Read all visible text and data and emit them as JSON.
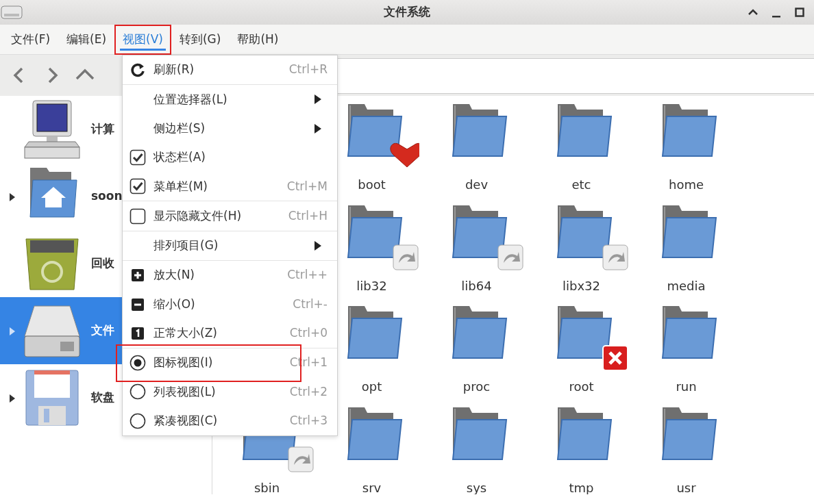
{
  "window": {
    "title": "文件系统"
  },
  "menubar": [
    {
      "label": "文件(F)",
      "selected": false,
      "highlighted": false
    },
    {
      "label": "编辑(E)",
      "selected": false,
      "highlighted": false
    },
    {
      "label": "视图(V)",
      "selected": true,
      "highlighted": true
    },
    {
      "label": "转到(G)",
      "selected": false,
      "highlighted": false
    },
    {
      "label": "帮助(H)",
      "selected": false,
      "highlighted": false
    }
  ],
  "sidebar": {
    "items": [
      {
        "label": "计算",
        "kind": "computer",
        "expandable": false,
        "selected": false
      },
      {
        "label": "soon",
        "kind": "home",
        "expandable": true,
        "selected": false
      },
      {
        "label": "回收",
        "kind": "trash",
        "expandable": false,
        "selected": false
      },
      {
        "label": "文件",
        "kind": "drive",
        "expandable": true,
        "selected": true
      },
      {
        "label": "软盘",
        "kind": "floppy",
        "expandable": true,
        "selected": false
      }
    ]
  },
  "view_menu": {
    "sections": [
      [
        {
          "kind": "action",
          "label": "刷新(R)",
          "shortcut": "Ctrl+R",
          "highlighted": false
        }
      ],
      [
        {
          "kind": "submenu",
          "label": "位置选择器(L)",
          "highlighted": false
        },
        {
          "kind": "submenu",
          "label": "侧边栏(S)",
          "highlighted": false
        },
        {
          "kind": "check",
          "label": "状态栏(A)",
          "checked": true,
          "highlighted": false
        },
        {
          "kind": "check",
          "label": "菜单栏(M)",
          "shortcut": "Ctrl+M",
          "checked": true,
          "highlighted": false
        }
      ],
      [
        {
          "kind": "check",
          "label": "显示隐藏文件(H)",
          "shortcut": "Ctrl+H",
          "checked": false,
          "highlighted": false
        }
      ],
      [
        {
          "kind": "submenu",
          "label": "排列项目(G)",
          "highlighted": false
        }
      ],
      [
        {
          "kind": "action",
          "label": "放大(N)",
          "shortcut": "Ctrl++",
          "highlighted": false
        },
        {
          "kind": "action",
          "label": "缩小(O)",
          "shortcut": "Ctrl+-",
          "highlighted": false
        },
        {
          "kind": "action",
          "label": "正常大小(Z)",
          "shortcut": "Ctrl+0",
          "highlighted": false
        }
      ],
      [
        {
          "kind": "radio",
          "label": "图标视图(I)",
          "shortcut": "Ctrl+1",
          "selected": true,
          "highlighted": true
        },
        {
          "kind": "radio",
          "label": "列表视图(L)",
          "shortcut": "Ctrl+2",
          "selected": false,
          "highlighted": false
        },
        {
          "kind": "radio",
          "label": "紧凑视图(C)",
          "shortcut": "Ctrl+3",
          "selected": false,
          "highlighted": false
        }
      ]
    ]
  },
  "files": {
    "rows": [
      [
        "",
        {
          "name": "boot",
          "kind": "favorite"
        },
        {
          "name": "dev",
          "kind": "folder"
        },
        {
          "name": "etc",
          "kind": "folder"
        },
        {
          "name": "home",
          "kind": "folder"
        }
      ],
      [
        "",
        {
          "name": "lib32",
          "kind": "link"
        },
        {
          "name": "lib64",
          "kind": "link"
        },
        {
          "name": "libx32",
          "kind": "link"
        },
        {
          "name": "media",
          "kind": "folder"
        }
      ],
      [
        "",
        {
          "name": "opt",
          "kind": "folder"
        },
        {
          "name": "proc",
          "kind": "folder"
        },
        {
          "name": "root",
          "kind": "locked"
        },
        {
          "name": "run",
          "kind": "folder"
        }
      ],
      [
        {
          "name": "sbin",
          "kind": "link"
        },
        {
          "name": "srv",
          "kind": "folder"
        },
        {
          "name": "sys",
          "kind": "folder"
        },
        {
          "name": "tmp",
          "kind": "folder"
        },
        {
          "name": "usr",
          "kind": "folder"
        }
      ]
    ]
  }
}
